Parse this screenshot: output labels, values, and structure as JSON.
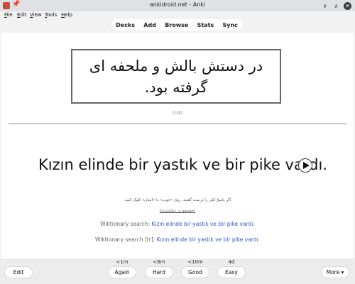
{
  "window": {
    "title": "ankidroid.net - Anki"
  },
  "menu": [
    {
      "label": "File",
      "accel": "F",
      "rest": "ile"
    },
    {
      "label": "Edit",
      "accel": "E",
      "rest": "dit"
    },
    {
      "label": "View",
      "accel": "V",
      "rest": "iew"
    },
    {
      "label": "Tools",
      "accel": "T",
      "rest": "ools"
    },
    {
      "label": "Help",
      "accel": "H",
      "rest": "elp"
    }
  ],
  "toolbar": {
    "decks": "Decks",
    "add": "Add",
    "browse": "Browse",
    "stats": "Stats",
    "sync": "Sync"
  },
  "card": {
    "question": "در دستش بالش و ملحفه ای گرفته بود.",
    "timer": "0:00",
    "answer": "Kızın elinde bir yastık ve bir pike vardı.",
    "hint_text": "اگر پاسخ کلی را درست گفتید، روی «خوب» یا «آسان» کلیک کنید.",
    "hint_link": "[جستجو در دیکشنری]",
    "wiki1_prefix": "Wiktionary search:",
    "wiki1_link": "Kızın elinde bir yastık ve bir pike vardı",
    "wiki1_suffix": ".",
    "wiki2_prefix": "Wiktionary search [tr]:",
    "wiki2_link": "Kızın elinde bir yastık ve bir pike vardı",
    "wiki2_suffix": "."
  },
  "bottom": {
    "edit": "Edit",
    "more": "More ▾",
    "answers": [
      {
        "interval": "<1m",
        "label": "Again"
      },
      {
        "interval": "<6m",
        "label": "Hard"
      },
      {
        "interval": "<10m",
        "label": "Good"
      },
      {
        "interval": "4d",
        "label": "Easy"
      }
    ]
  }
}
